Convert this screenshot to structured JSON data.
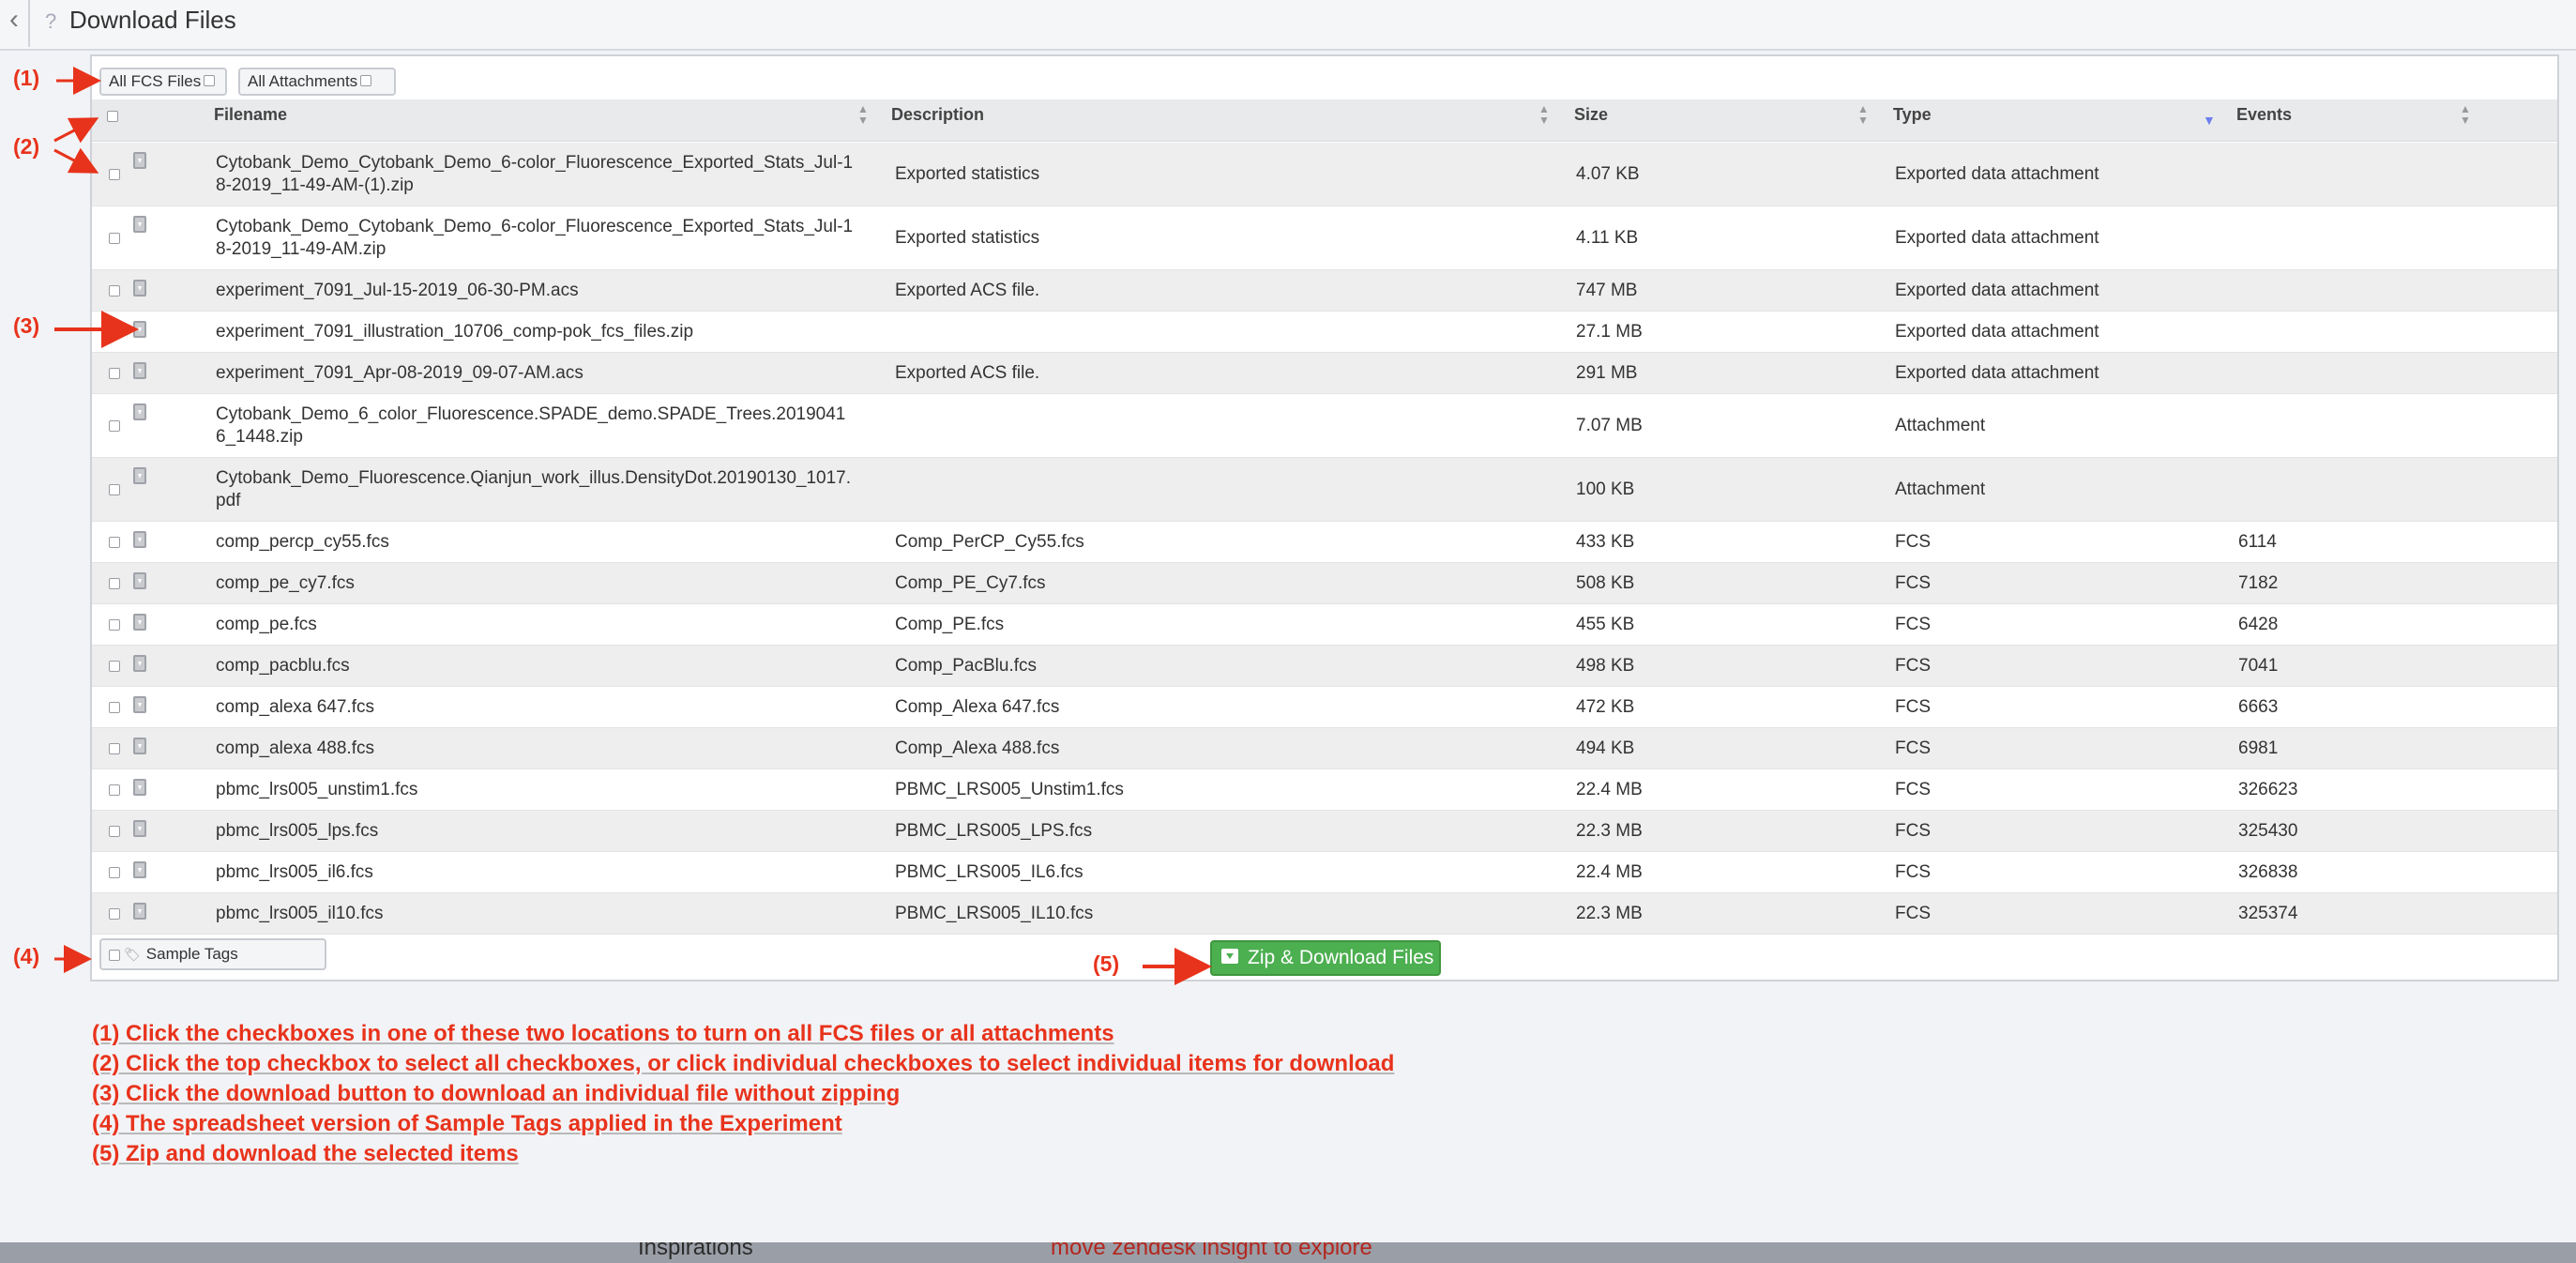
{
  "header": {
    "back_icon": "chevron-left-icon",
    "help_mark": "?",
    "title": "Download Files"
  },
  "filters": {
    "all_fcs_label": "All FCS Files",
    "all_attachments_label": "All Attachments"
  },
  "table": {
    "columns": [
      "Filename",
      "Description",
      "Size",
      "Type",
      "Events"
    ],
    "sorted_column": "Type",
    "rows": [
      {
        "filename": "Cytobank_Demo_Cytobank_Demo_6-color_Fluorescence_Exported_Stats_Jul-18-2019_11-49-AM-(1).zip",
        "description": "Exported statistics",
        "size": "4.07 KB",
        "type": "Exported data attachment",
        "events": ""
      },
      {
        "filename": "Cytobank_Demo_Cytobank_Demo_6-color_Fluorescence_Exported_Stats_Jul-18-2019_11-49-AM.zip",
        "description": "Exported statistics",
        "size": "4.11 KB",
        "type": "Exported data attachment",
        "events": ""
      },
      {
        "filename": "experiment_7091_Jul-15-2019_06-30-PM.acs",
        "description": "Exported ACS file.",
        "size": "747 MB",
        "type": "Exported data attachment",
        "events": ""
      },
      {
        "filename": "experiment_7091_illustration_10706_comp-pok_fcs_files.zip",
        "description": "",
        "size": "27.1 MB",
        "type": "Exported data attachment",
        "events": ""
      },
      {
        "filename": "experiment_7091_Apr-08-2019_09-07-AM.acs",
        "description": "Exported ACS file.",
        "size": "291 MB",
        "type": "Exported data attachment",
        "events": ""
      },
      {
        "filename": "Cytobank_Demo_6_color_Fluorescence.SPADE_demo.SPADE_Trees.20190416_1448.zip",
        "description": "",
        "size": "7.07 MB",
        "type": "Attachment",
        "events": ""
      },
      {
        "filename": "Cytobank_Demo_Fluorescence.Qianjun_work_illus.DensityDot.20190130_1017.pdf",
        "description": "",
        "size": "100 KB",
        "type": "Attachment",
        "events": ""
      },
      {
        "filename": "comp_percp_cy55.fcs",
        "description": "Comp_PerCP_Cy55.fcs",
        "size": "433 KB",
        "type": "FCS",
        "events": "6114"
      },
      {
        "filename": "comp_pe_cy7.fcs",
        "description": "Comp_PE_Cy7.fcs",
        "size": "508 KB",
        "type": "FCS",
        "events": "7182"
      },
      {
        "filename": "comp_pe.fcs",
        "description": "Comp_PE.fcs",
        "size": "455 KB",
        "type": "FCS",
        "events": "6428"
      },
      {
        "filename": "comp_pacblu.fcs",
        "description": "Comp_PacBlu.fcs",
        "size": "498 KB",
        "type": "FCS",
        "events": "7041"
      },
      {
        "filename": "comp_alexa 647.fcs",
        "description": "Comp_Alexa 647.fcs",
        "size": "472 KB",
        "type": "FCS",
        "events": "6663"
      },
      {
        "filename": "comp_alexa 488.fcs",
        "description": "Comp_Alexa 488.fcs",
        "size": "494 KB",
        "type": "FCS",
        "events": "6981"
      },
      {
        "filename": "pbmc_lrs005_unstim1.fcs",
        "description": "PBMC_LRS005_Unstim1.fcs",
        "size": "22.4 MB",
        "type": "FCS",
        "events": "326623"
      },
      {
        "filename": "pbmc_lrs005_lps.fcs",
        "description": "PBMC_LRS005_LPS.fcs",
        "size": "22.3 MB",
        "type": "FCS",
        "events": "325430"
      },
      {
        "filename": "pbmc_lrs005_il6.fcs",
        "description": "PBMC_LRS005_IL6.fcs",
        "size": "22.4 MB",
        "type": "FCS",
        "events": "326838"
      },
      {
        "filename": "pbmc_lrs005_il10.fcs",
        "description": "PBMC_LRS005_IL10.fcs",
        "size": "22.3 MB",
        "type": "FCS",
        "events": "325374"
      }
    ]
  },
  "footer": {
    "sample_tags_label": "Sample Tags",
    "zip_button_label": "Zip & Download Files"
  },
  "annotations": {
    "markers": [
      "(1)",
      "(2)",
      "(3)",
      "(4)",
      "(5)"
    ],
    "notes": [
      "(1) Click the checkboxes in one of these two locations to turn on all FCS files or all attachments",
      "(2) Click the top checkbox to select all checkboxes, or click individual checkboxes to select individual items for download",
      "(3) Click the download button to download an individual file without zipping",
      "(4) The spreadsheet version of Sample Tags applied in the Experiment",
      "(5) Zip and download the selected items"
    ]
  },
  "background_strip": {
    "left_text": "Inspirations",
    "right_text": "move zendesk insight to explore"
  },
  "colors": {
    "annotation": "#e8331c",
    "zip_button": "#4caf50",
    "alt_row": "#eeeeef",
    "header_row": "#e9eaec",
    "sort_active": "#6f7ff0"
  },
  "icons": {
    "download": "download-file-icon",
    "tag": "tag-icon",
    "zip": "archive-icon",
    "sort": "sort-arrows-icon"
  }
}
